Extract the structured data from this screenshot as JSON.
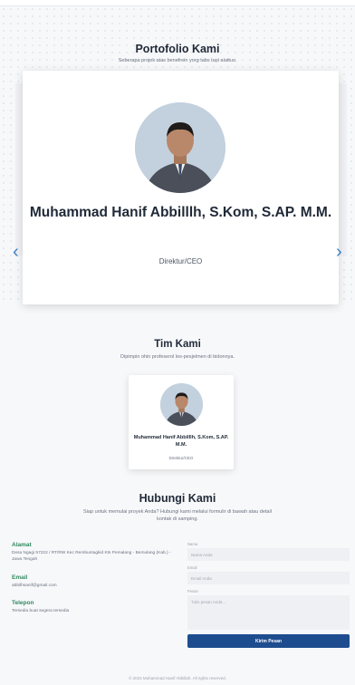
{
  "portfolio": {
    "title": "Portofolio Kami",
    "subtitle": "Seberapa projek atas benefrein yorg tabs tupi alattus.",
    "card": {
      "name": "Muhammad Hanif Abbilllh, S.Kom, S.AP. M.M.",
      "role": "Direktur/CEO"
    },
    "prev_icon": "chevron-left-icon",
    "next_icon": "chevron-right-icon"
  },
  "team": {
    "title": "Tim Kami",
    "subtitle": "Dipimpin ohin profeserol les-pesjelmen di bidonnya.",
    "member": {
      "name": "Muhammad Hanif Abbilllh, S.Kom, S.AP. M.M.",
      "role": "Direktur/CEO"
    }
  },
  "contact": {
    "title": "Hubungi Kami",
    "subtitle": "Siap untuk memulai proyek Anda? Hubungi kami melalui formulir di bawah atau detail kontak di samping.",
    "info": [
      {
        "label": "Alamat",
        "text": "Desa Ngagi 57222 / RT/RW Kec Rembuntagkid Kts Pemalang - Bemulang (Kab.) - Jawa Tengah"
      },
      {
        "label": "Email",
        "text": "abbilhsanif@gmail.com"
      },
      {
        "label": "Telepon",
        "text": "Tersedia buat segera tersedia"
      }
    ],
    "form": {
      "name_label": "Nama",
      "name_placeholder": "Nama Anda",
      "email_label": "Email",
      "email_placeholder": "Email Anda",
      "message_label": "Pesan",
      "message_placeholder": "Tulis pesan Anda...",
      "submit_label": "Kirim Pesan"
    }
  },
  "footer": {
    "text": "© 2024 Muhammad Hanif Abbillah. All rights reserved."
  },
  "colors": {
    "accent": "#1e4d8f",
    "info_label": "#2f8a5f",
    "arrow": "#3b82c4"
  }
}
